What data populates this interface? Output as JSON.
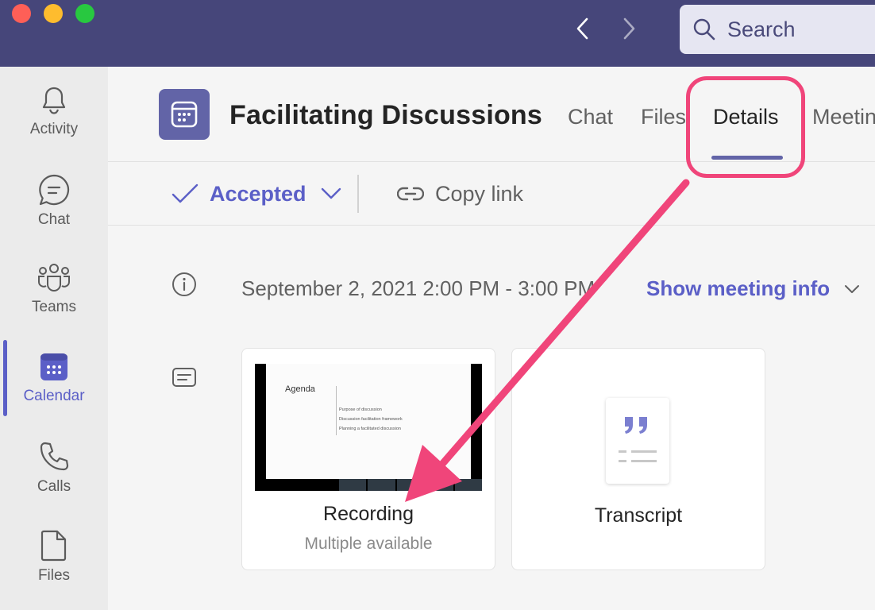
{
  "window": {
    "search_placeholder": "Search"
  },
  "rail": {
    "items": [
      {
        "label": "Activity",
        "icon": "bell-icon"
      },
      {
        "label": "Chat",
        "icon": "chat-icon"
      },
      {
        "label": "Teams",
        "icon": "teams-icon"
      },
      {
        "label": "Calendar",
        "icon": "calendar-icon",
        "active": true
      },
      {
        "label": "Calls",
        "icon": "phone-icon"
      },
      {
        "label": "Files",
        "icon": "file-icon"
      }
    ]
  },
  "meeting": {
    "title": "Facilitating Discussions",
    "tabs": [
      {
        "label": "Chat"
      },
      {
        "label": "Files"
      },
      {
        "label": "Details",
        "active": true
      },
      {
        "label": "Meetin"
      }
    ]
  },
  "toolbar": {
    "response_label": "Accepted",
    "copy_link_label": "Copy link"
  },
  "details": {
    "datetime": "September 2, 2021 2:00 PM - 3:00 PM",
    "show_info_label": "Show meeting info"
  },
  "cards": {
    "recording": {
      "label": "Recording",
      "sublabel": "Multiple available",
      "slide_title": "Agenda",
      "slide_bullets": [
        "Purpose of discussion",
        "Discussion facilitation framework",
        "Planning a facilitated discussion"
      ]
    },
    "transcript": {
      "label": "Transcript"
    }
  },
  "colors": {
    "titlebar": "#46467a",
    "accent": "#5b5fc7",
    "annotation": "#f0457a"
  }
}
